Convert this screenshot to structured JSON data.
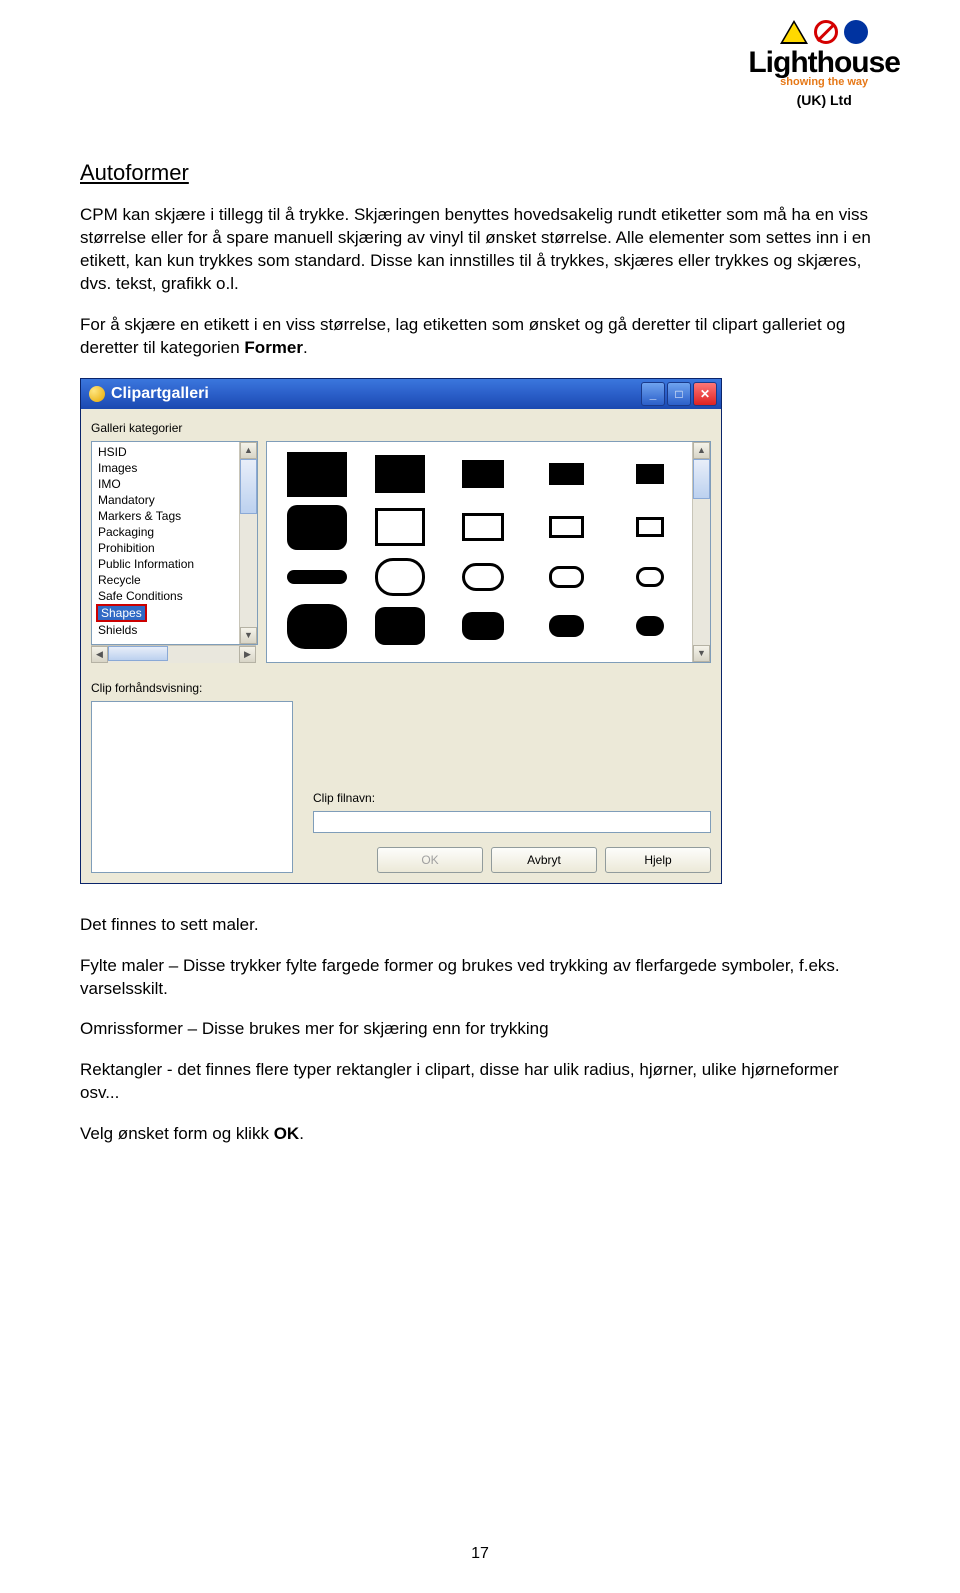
{
  "logo": {
    "name": "Lighthouse",
    "tagline": "showing the way",
    "suffix": "(UK) Ltd"
  },
  "doc": {
    "heading": "Autoformer",
    "p1": "CPM kan skjære i tillegg til å trykke. Skjæringen benyttes hovedsakelig rundt etiketter som må ha en viss størrelse eller for å spare manuell skjæring av vinyl til ønsket størrelse. Alle elementer som settes inn i en etikett, kan kun trykkes som standard. Disse kan innstilles til å trykkes, skjæres eller trykkes og skjæres, dvs. tekst, grafikk o.l.",
    "p2a": "For å skjære en etikett i en viss størrelse, lag etiketten som ønsket og gå deretter til clipart galleriet og deretter til kategorien ",
    "p2b": "Former",
    "p2c": ".",
    "p3": "Det finnes to sett maler.",
    "p4": "Fylte maler – Disse trykker fylte fargede former og brukes ved trykking av flerfargede symboler, f.eks. varselsskilt.",
    "p5": "Omrissformer – Disse brukes mer for skjæring enn for trykking",
    "p6": "Rektangler - det finnes flere typer rektangler i clipart, disse har ulik radius, hjørner, ulike hjørneformer osv...",
    "p7a": "Velg ønsket form og klikk ",
    "p7b": "OK",
    "p7c": ".",
    "page_number": "17"
  },
  "dialog": {
    "title": "Clipartgalleri",
    "categories_label": "Galleri kategorier",
    "categories": [
      "HSID",
      "Images",
      "IMO",
      "Mandatory",
      "Markers & Tags",
      "Packaging",
      "Prohibition",
      "Public Information",
      "Recycle",
      "Safe Conditions",
      "Shapes",
      "Shields"
    ],
    "selected_index": 10,
    "preview_label": "Clip forhåndsvisning:",
    "filename_label": "Clip filnavn:",
    "filename_value": "",
    "buttons": {
      "ok": "OK",
      "cancel": "Avbryt",
      "help": "Hjelp"
    }
  }
}
